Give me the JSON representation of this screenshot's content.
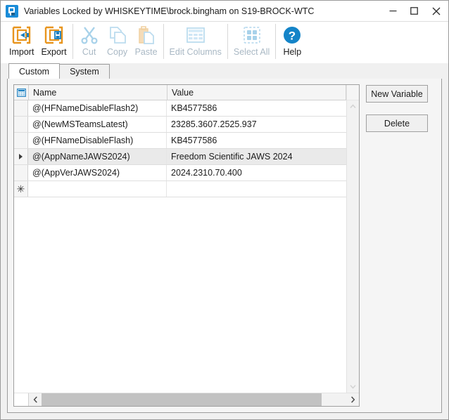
{
  "window": {
    "title": "Variables Locked by WHISKEYTIME\\brock.bingham on S19-BROCK-WTC",
    "app_icon": "app-logo-icon",
    "controls": {
      "minimize": "minimize-icon",
      "maximize": "maximize-icon",
      "close": "close-icon"
    }
  },
  "toolbar": {
    "items": [
      {
        "label": "Import",
        "icon": "import-icon",
        "enabled": true
      },
      {
        "label": "Export",
        "icon": "export-icon",
        "enabled": true
      },
      {
        "label": "Cut",
        "icon": "scissors-icon",
        "enabled": false
      },
      {
        "label": "Copy",
        "icon": "copy-icon",
        "enabled": false
      },
      {
        "label": "Paste",
        "icon": "paste-icon",
        "enabled": false
      },
      {
        "label": "Edit Columns",
        "icon": "table-icon",
        "enabled": false
      },
      {
        "label": "Select All",
        "icon": "select-all-icon",
        "enabled": false
      },
      {
        "label": "Help",
        "icon": "help-icon",
        "enabled": true
      }
    ]
  },
  "tabs": [
    {
      "label": "Custom",
      "active": true
    },
    {
      "label": "System",
      "active": false
    }
  ],
  "grid": {
    "select_all_icon": "grid-select-all-icon",
    "columns": [
      "Name",
      "Value"
    ],
    "rows": [
      {
        "name": "@(HFNameDisableFlash2)",
        "value": "KB4577586",
        "selected": false,
        "marker": ""
      },
      {
        "name": "@(NewMSTeamsLatest)",
        "value": "23285.3607.2525.937",
        "selected": false,
        "marker": ""
      },
      {
        "name": "@(HFNameDisableFlash)",
        "value": "KB4577586",
        "selected": false,
        "marker": ""
      },
      {
        "name": "@(AppNameJAWS2024)",
        "value": "Freedom Scientific JAWS 2024",
        "selected": true,
        "marker": "caret"
      },
      {
        "name": "@(AppVerJAWS2024)",
        "value": "2024.2310.70.400",
        "selected": false,
        "marker": ""
      },
      {
        "name": "",
        "value": "",
        "selected": false,
        "marker": "new"
      }
    ],
    "new_row_glyph": "✳",
    "vscroll": {
      "up_icon": "scroll-up-icon",
      "down_icon": "scroll-down-icon"
    },
    "hscroll": {
      "left_icon": "scroll-left-icon",
      "right_icon": "scroll-right-icon",
      "thumb_percent": 92
    }
  },
  "side_buttons": [
    {
      "label": "New Variable",
      "name": "new-variable-button"
    },
    {
      "label": "Delete",
      "name": "delete-button"
    }
  ],
  "colors": {
    "accent_blue": "#1a8cd8",
    "import_orange": "#e8951e",
    "disabled_blue": "#c3dcee",
    "selection_gray": "#eaeaea"
  }
}
